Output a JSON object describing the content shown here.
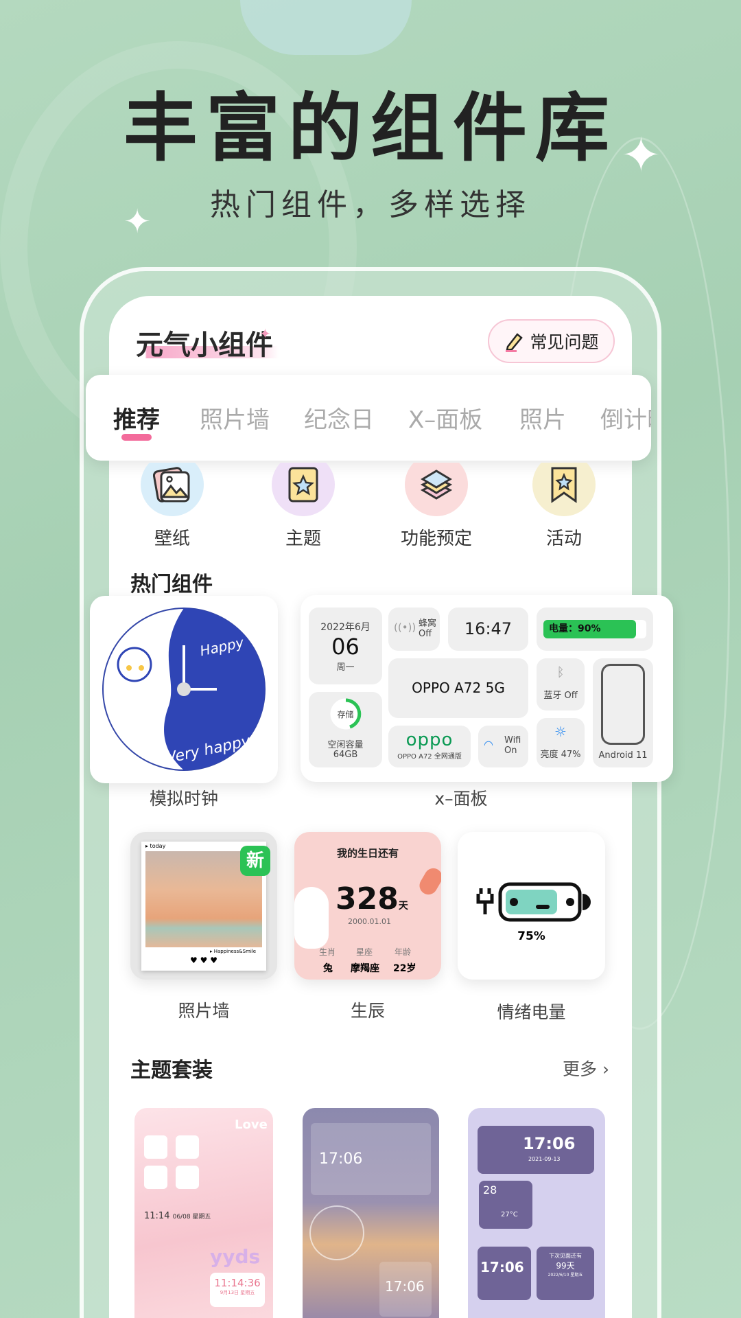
{
  "hero": {
    "title": "丰富的组件库",
    "subtitle": "热门组件，多样选择"
  },
  "app": {
    "title": "元气小组件",
    "faq_label": "常见问题"
  },
  "tabs": [
    {
      "label": "推荐",
      "active": true
    },
    {
      "label": "照片墙"
    },
    {
      "label": "纪念日"
    },
    {
      "label": "X–面板"
    },
    {
      "label": "照片"
    },
    {
      "label": "倒计时"
    }
  ],
  "categories": [
    {
      "label": "壁纸",
      "icon": "wallpaper-icon",
      "color": "#d9eefa"
    },
    {
      "label": "主题",
      "icon": "theme-icon",
      "color": "#efe0f7"
    },
    {
      "label": "功能预定",
      "icon": "layers-icon",
      "color": "#fbdcdc"
    },
    {
      "label": "活动",
      "icon": "bookmark-star-icon",
      "color": "#f6efcf"
    }
  ],
  "hot": {
    "title": "热门组件",
    "clock": {
      "label": "模拟时钟",
      "text_top": "Happy",
      "text_bottom": "Very happy"
    },
    "xpanel": {
      "label": "x–面板",
      "date_month": "2022年6月",
      "date_day": "06",
      "date_week": "周一",
      "cell_label": "蜂窝",
      "cell_state": "Off",
      "time": "16:47",
      "battery": "电量：90%",
      "battery_level": 90,
      "model": "OPPO A72 5G",
      "bt": "蓝牙 Off",
      "android": "Android 11",
      "storage": "存储",
      "storage_free": "空闲容量",
      "storage_size": "64GB",
      "brand": "oppo",
      "brand_sub": "OPPO A72 全网通版",
      "wifi_label": "Wifi",
      "wifi_state": "On",
      "brightness": "亮度 47%"
    },
    "photo": {
      "label": "照片墙",
      "today": "▸ today",
      "badge": "新",
      "caption": "▸ Happiness&Smile",
      "hearts": "♥ ♥ ♥"
    },
    "birthday": {
      "label": "生辰",
      "title": "我的生日还有",
      "days": "328",
      "unit": "天",
      "date": "2000.01.01",
      "h1": "生肖",
      "h2": "星座",
      "h3": "年龄",
      "v1": "兔",
      "v2": "摩羯座",
      "v3": "22岁"
    },
    "mood": {
      "label": "情绪电量",
      "percent": "75%",
      "level": 75
    }
  },
  "themes": {
    "title": "主题套装",
    "more": "更多",
    "t1": {
      "love": "Love",
      "time": "11:14",
      "date": "06/08 星期五",
      "yyds": "yyds",
      "clock": "11:14:36",
      "d1": "9月13日",
      "d2": "星期五"
    },
    "t2": {
      "time": "17:06",
      "time2": "17:06"
    },
    "t3": {
      "time": "17:06",
      "date": "2021-09-13",
      "day": "28",
      "temp": "27°C",
      "time2": "17:06",
      "count": "下次见面还有",
      "days": "99天",
      "date2": "2022/6/10 星期五"
    }
  },
  "colors": {
    "accent": "#f36b9b",
    "battery": "#2bc255",
    "oppo": "#0b9a54",
    "bg": "#a9d3b6"
  }
}
